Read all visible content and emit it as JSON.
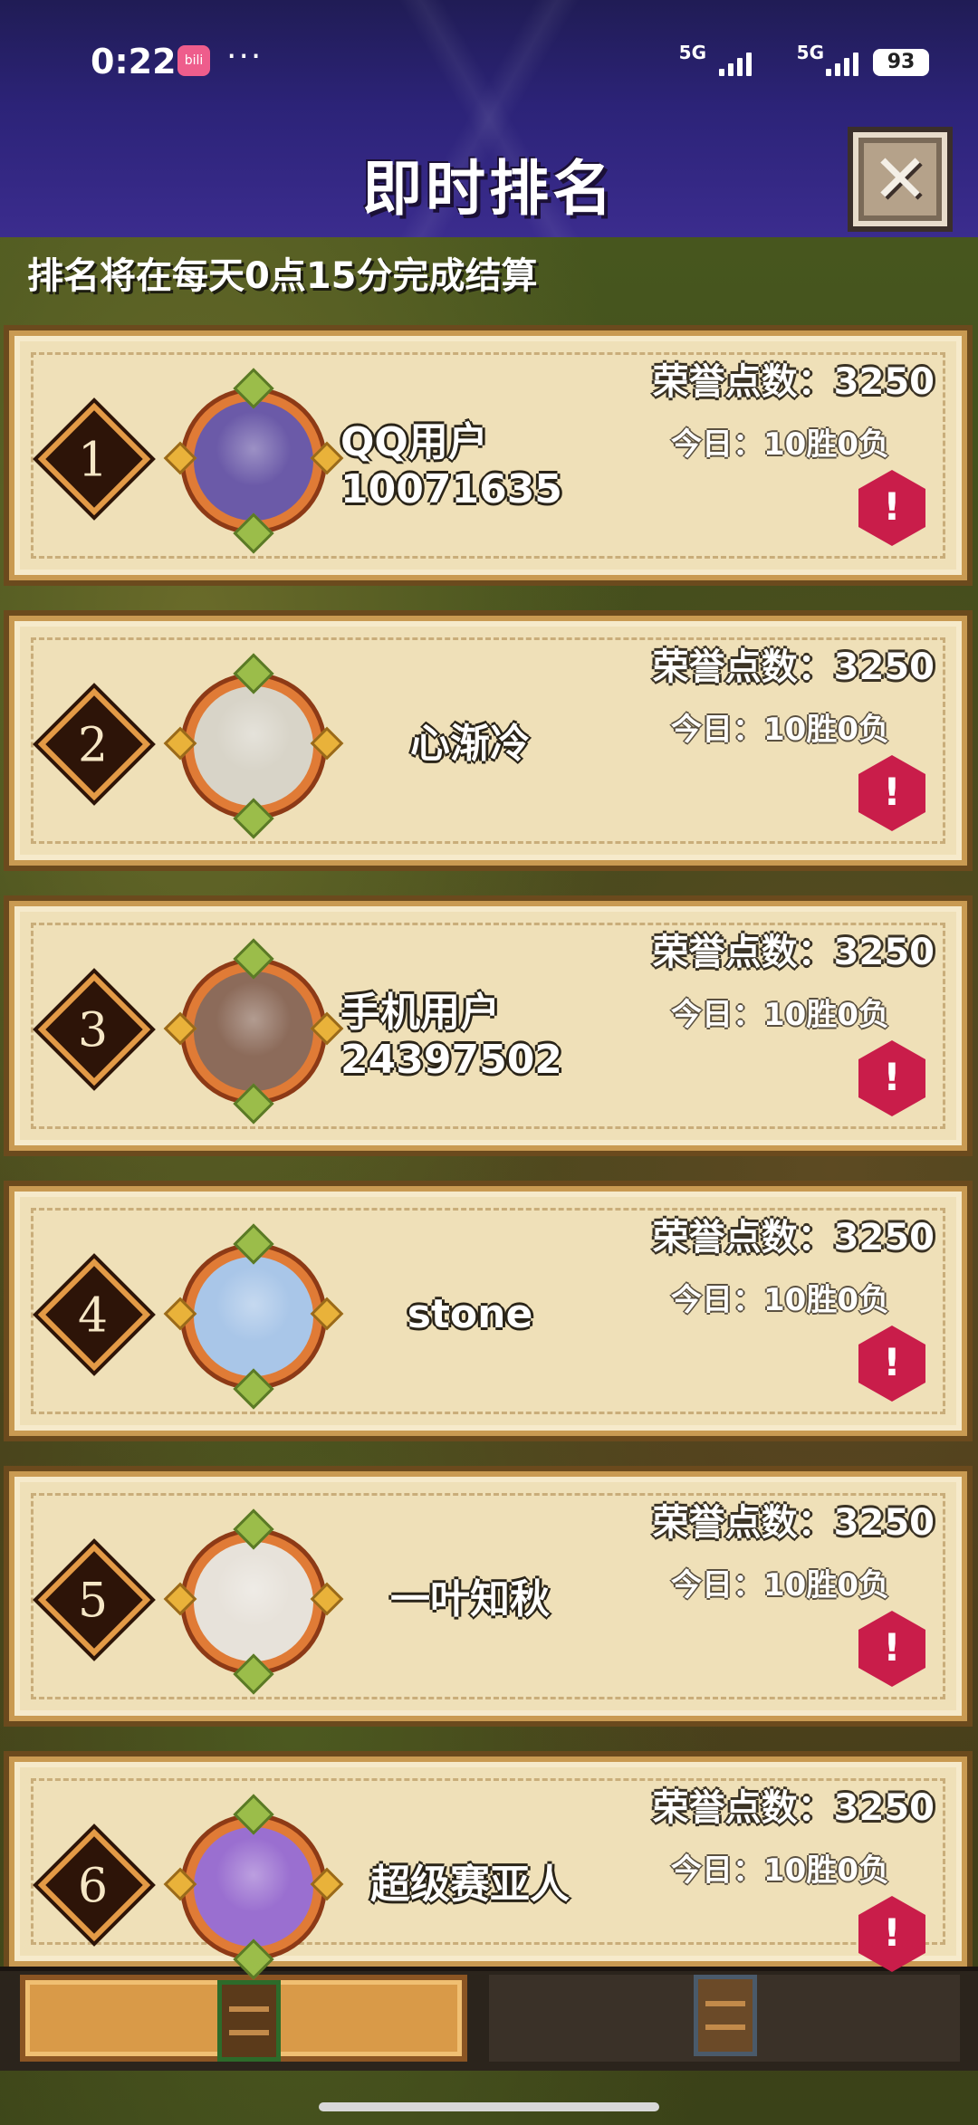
{
  "status_bar": {
    "time": "0:22",
    "app_icon_label": "bili",
    "more": "···",
    "network1": "5G",
    "network2": "5G",
    "battery": "93"
  },
  "header": {
    "title": "即时排名",
    "close_icon": "close-x-icon"
  },
  "notice": "排名将在每天0点15分完成结算",
  "rankings": [
    {
      "rank": "1",
      "name": "QQ用户\n10071635",
      "honor": "荣誉点数：3250",
      "today": "今日：10胜0负",
      "avatar_color": "#6b5aa8"
    },
    {
      "rank": "2",
      "name": "心渐冷",
      "honor": "荣誉点数：3250",
      "today": "今日：10胜0负",
      "avatar_color": "#d8d4c8"
    },
    {
      "rank": "3",
      "name": "手机用户\n24397502",
      "honor": "荣誉点数：3250",
      "today": "今日：10胜0负",
      "avatar_color": "#8c6b5a"
    },
    {
      "rank": "4",
      "name": "stone",
      "honor": "荣誉点数：3250",
      "today": "今日：10胜0负",
      "avatar_color": "#a9c6e8"
    },
    {
      "rank": "5",
      "name": "一叶知秋",
      "honor": "荣誉点数：3250",
      "today": "今日：10胜0负",
      "avatar_color": "#e7e2da"
    },
    {
      "rank": "6",
      "name": "超级赛亚人",
      "honor": "荣誉点数：3250",
      "today": "今日：10胜0负",
      "avatar_color": "#9a6fd0"
    }
  ],
  "report_icon": "warning-icon",
  "bottom_tabs": [
    {
      "name": "ranking-tab",
      "active": true
    },
    {
      "name": "other-tab",
      "active": false
    }
  ]
}
